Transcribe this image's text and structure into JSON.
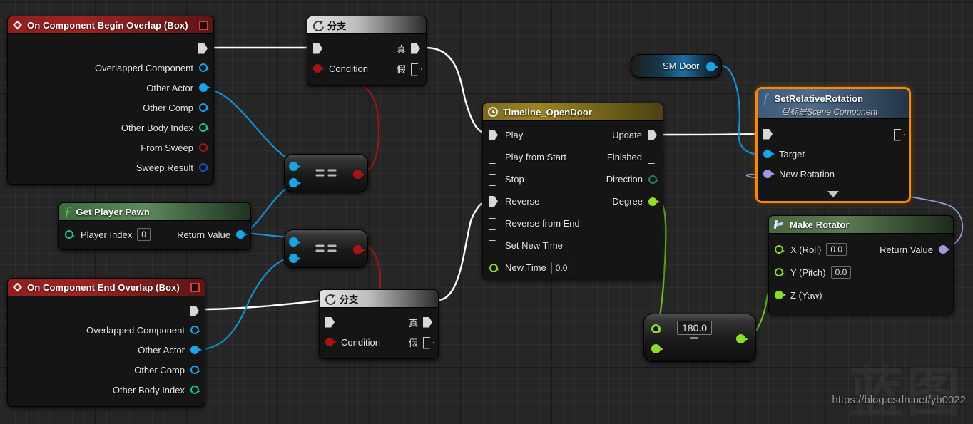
{
  "app": {
    "name": "Unreal Engine Blueprint Graph"
  },
  "watermark": {
    "cn_text": "蓝图",
    "url": "https://blog.csdn.net/yb0022"
  },
  "colors": {
    "canvas_bg": "#262626",
    "event_header": "#a02323",
    "timeline_header": "#9c8520",
    "function_header": "#4e6b8a",
    "makerotator_header": "#5c7d53",
    "selection": "#f08a10",
    "pin_object": "#18a5e8",
    "pin_int": "#1fc48c",
    "pin_bool": "#a81414",
    "pin_struct": "#1f4fc4",
    "pin_float": "#8cdd2a",
    "pin_rotator": "#9a9ce0",
    "pin_byte": "#1d7f72",
    "exec_wire": "#ffffff"
  },
  "nodes": {
    "begin_overlap": {
      "title": "On Component Begin Overlap (Box)",
      "outputs": [
        {
          "label": "Overlapped Component",
          "type": "object"
        },
        {
          "label": "Other Actor",
          "type": "object"
        },
        {
          "label": "Other Comp",
          "type": "object"
        },
        {
          "label": "Other Body Index",
          "type": "int"
        },
        {
          "label": "From Sweep",
          "type": "bool"
        },
        {
          "label": "Sweep Result",
          "type": "struct"
        }
      ]
    },
    "end_overlap": {
      "title": "On Component End Overlap (Box)",
      "outputs": [
        {
          "label": "Overlapped Component",
          "type": "object"
        },
        {
          "label": "Other Actor",
          "type": "object"
        },
        {
          "label": "Other Comp",
          "type": "object"
        },
        {
          "label": "Other Body Index",
          "type": "int"
        }
      ]
    },
    "branch_top": {
      "title": "分支",
      "condition_label": "Condition",
      "true_label": "真",
      "false_label": "假"
    },
    "branch_bottom": {
      "title": "分支",
      "condition_label": "Condition",
      "true_label": "真",
      "false_label": "假"
    },
    "get_player_pawn": {
      "title": "Get Player Pawn",
      "input_label": "Player Index",
      "input_value": "0",
      "output_label": "Return Value"
    },
    "equal_top": {
      "symbol": "=="
    },
    "equal_bottom": {
      "symbol": "=="
    },
    "timeline": {
      "title": "Timeline_OpenDoor",
      "inputs": [
        {
          "label": "Play",
          "type": "exec",
          "connected": true
        },
        {
          "label": "Play from Start",
          "type": "exec",
          "connected": false
        },
        {
          "label": "Stop",
          "type": "exec",
          "connected": false
        },
        {
          "label": "Reverse",
          "type": "exec",
          "connected": true
        },
        {
          "label": "Reverse from End",
          "type": "exec",
          "connected": false
        },
        {
          "label": "Set New Time",
          "type": "exec",
          "connected": false
        },
        {
          "label": "New Time",
          "type": "float",
          "value": "0.0"
        }
      ],
      "outputs": [
        {
          "label": "Update",
          "type": "exec",
          "connected": true
        },
        {
          "label": "Finished",
          "type": "exec",
          "connected": false
        },
        {
          "label": "Direction",
          "type": "byte"
        },
        {
          "label": "Degree",
          "type": "float"
        }
      ]
    },
    "sm_door": {
      "label": "SM Door"
    },
    "set_relative_rotation": {
      "title": "SetRelativeRotation",
      "subtitle": "目标是Scene Component",
      "inputs": [
        {
          "label": "Target",
          "type": "object"
        },
        {
          "label": "New Rotation",
          "type": "rotator"
        }
      ],
      "selected": true
    },
    "make_rotator": {
      "title": "Make Rotator",
      "inputs": [
        {
          "label": "X (Roll)",
          "type": "float",
          "value": "0.0"
        },
        {
          "label": "Y (Pitch)",
          "type": "float",
          "value": "0.0"
        },
        {
          "label": "Z (Yaw)",
          "type": "float",
          "value": ""
        }
      ],
      "output_label": "Return Value"
    },
    "multiply": {
      "value": "180.0"
    }
  }
}
